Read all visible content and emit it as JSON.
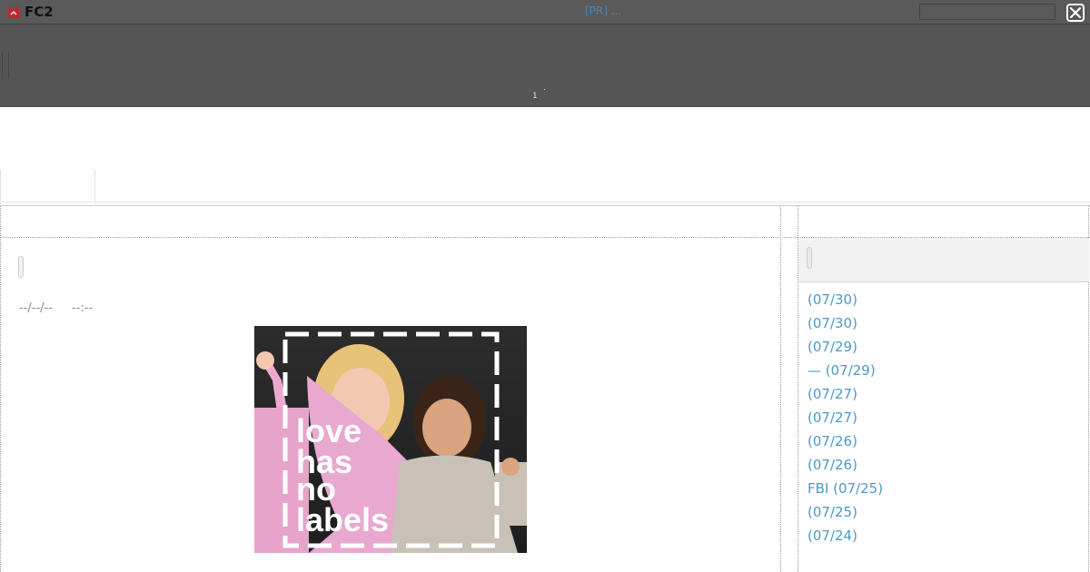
{
  "topbar": {
    "logo_text": "FC2",
    "pr_link": "[PR] ...",
    "search_value": ""
  },
  "banner": {
    "page_number": "1"
  },
  "entry": {
    "date": "--/--/--",
    "time": "--:--",
    "image": {
      "overlay_text": [
        "love",
        "has",
        "no",
        "labels"
      ]
    }
  },
  "sidebar": {
    "recent_entries": [
      " (07/30)",
      " (07/30)",
      " (07/29)",
      "— (07/29)",
      " (07/27)",
      " (07/27)",
      " (07/26)",
      " (07/26)",
      "FBI (07/25)",
      " (07/25)",
      " (07/24)"
    ]
  },
  "colors": {
    "topbar": "#5a5a5a",
    "banner": "#555555",
    "link": "#4a9ac4",
    "pr_link": "#4a86b8"
  }
}
